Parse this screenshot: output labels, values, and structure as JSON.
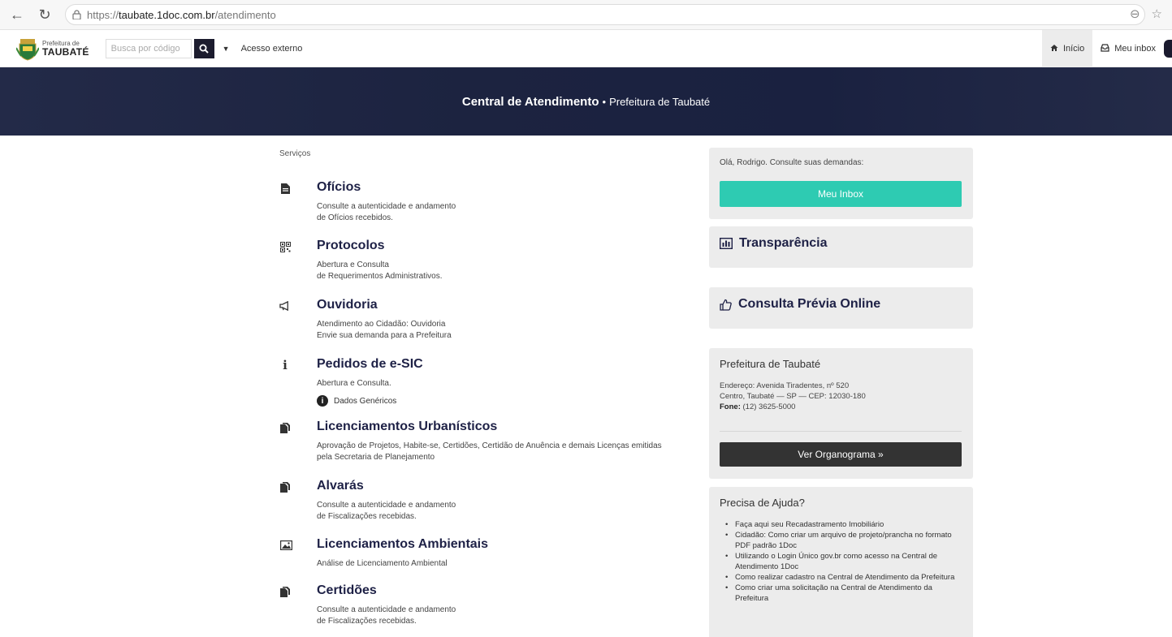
{
  "browser": {
    "url_prefix": "https://",
    "url_host": "taubate.1doc.com.br",
    "url_path": "/atendimento"
  },
  "navbar": {
    "logo_small": "Prefeitura de",
    "logo_big": "TAUBATÉ",
    "search_placeholder": "Busca por código",
    "external_link": "Acesso externo",
    "home_label": "Início",
    "inbox_label": "Meu inbox"
  },
  "banner": {
    "title": "Central de Atendimento",
    "separator": "•",
    "subtitle": "Prefeitura de Taubaté"
  },
  "services": {
    "title": "Serviços",
    "items": [
      {
        "title": "Ofícios",
        "desc1": "Consulte a autenticidade e andamento",
        "desc2": "de Ofícios recebidos.",
        "icon": "document-icon"
      },
      {
        "title": "Protocolos",
        "desc1": "Abertura e Consulta",
        "desc2": "de Requerimentos Administrativos.",
        "icon": "qrcode-icon"
      },
      {
        "title": "Ouvidoria",
        "desc1": "Atendimento ao Cidadão: Ouvidoria",
        "desc2": "Envie sua demanda para a Prefeitura",
        "icon": "megaphone-icon"
      },
      {
        "title": "Pedidos de e-SIC",
        "desc1": "Abertura e Consulta.",
        "desc2": "",
        "icon": "info-icon",
        "extra": "Dados Genéricos"
      },
      {
        "title": "Licenciamentos Urbanísticos",
        "desc1": "Aprovação de Projetos, Habite-se, Certidões, Certidão de Anuência e demais Licenças emitidas",
        "desc2": "pela Secretaria de Planejamento",
        "icon": "documents-icon"
      },
      {
        "title": "Alvarás",
        "desc1": "Consulte a autenticidade e andamento",
        "desc2": "de Fiscalizações recebidas.",
        "icon": "documents-icon"
      },
      {
        "title": "Licenciamentos Ambientais",
        "desc1": "Análise de Licenciamento Ambiental",
        "desc2": "",
        "icon": "image-icon"
      },
      {
        "title": "Certidões",
        "desc1": "Consulte a autenticidade e andamento",
        "desc2": "de Fiscalizações recebidas.",
        "icon": "documents-icon"
      }
    ]
  },
  "sidebar": {
    "greeting": "Olá, Rodrigo. Consulte suas demandas:",
    "inbox_button": "Meu Inbox",
    "transparencia": "Transparência",
    "consulta": "Consulta Prévia Online",
    "prefeitura_heading": "Prefeitura de Taubaté",
    "address1": "Endereço: Avenida Tiradentes, nº 520",
    "address2": "Centro, Taubaté — SP — CEP: 12030-180",
    "phone_label": "Fone:",
    "phone_value": "(12) 3625-5000",
    "org_button": "Ver Organograma »",
    "help_heading": "Precisa de Ajuda?",
    "help_items": [
      "Faça aqui seu Recadastramento Imobiliário",
      "Cidadão: Como criar um arquivo de projeto/prancha no formato PDF padrão 1Doc",
      "Utilizando o Login Único gov.br como acesso na Central de Atendimento 1Doc",
      "Como realizar cadastro na Central de Atendimento da Prefeitura",
      "Como criar uma solicitação na Central de Atendimento da Prefeitura"
    ]
  },
  "colors": {
    "banner": "#1c2340",
    "inbox_button": "#2ecbb2",
    "title_navy": "#1e2146",
    "org_button": "#333333"
  }
}
